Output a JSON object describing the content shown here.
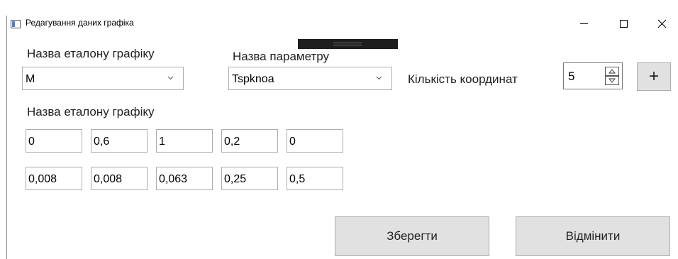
{
  "window": {
    "title": "Редагування даних графіка",
    "icon": "app-window-icon"
  },
  "form": {
    "etalon_label": "Назва еталону графіку",
    "etalon_value": "M",
    "param_label": "Назва параметру",
    "param_value": "Tspknoa",
    "coord_count_label": "Кількість координат",
    "coord_count_value": "5",
    "add_label": "+",
    "table_label": "Назва еталону графіку",
    "rows": [
      [
        "0",
        "0,6",
        "1",
        "0,2",
        "0"
      ],
      [
        "0,008",
        "0,008",
        "0,063",
        "0,25",
        "0,5"
      ]
    ]
  },
  "buttons": {
    "save": "Зберегти",
    "cancel": "Відмінити"
  }
}
